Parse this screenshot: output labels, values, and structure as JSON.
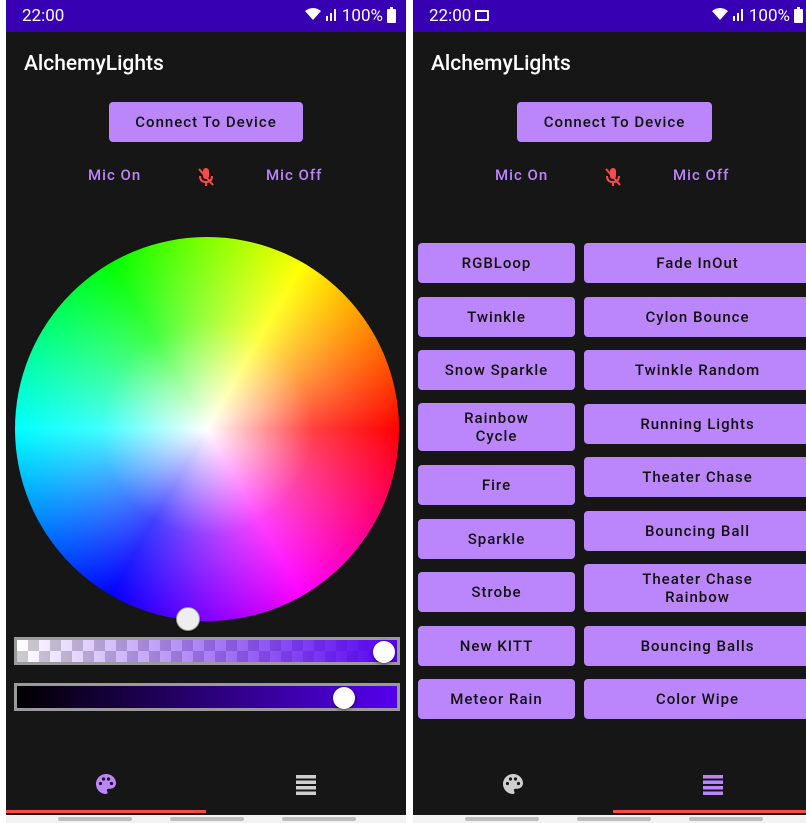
{
  "colors": {
    "accent": "#bb86fc",
    "status_bar": "#3700b3",
    "background": "#161616",
    "tab_indicator": "#ff4a4a",
    "mic_icon": "#ff4a4a"
  },
  "status_bar": {
    "time": "22:00",
    "battery": "100%"
  },
  "app": {
    "title": "AlchemyLights",
    "connect_label": "Connect To Device",
    "mic_on_label": "Mic On",
    "mic_off_label": "Mic Off"
  },
  "color_picker": {
    "selected_color": "#5500ee",
    "opacity": 1.0,
    "brightness": 0.93
  },
  "tabs": [
    {
      "icon": "palette-icon"
    },
    {
      "icon": "menu-icon"
    }
  ],
  "effects": {
    "left_column": [
      "RGBLoop",
      "Twinkle",
      "Snow Sparkle",
      "Rainbow\nCycle",
      "Fire",
      "Sparkle",
      "Strobe",
      "New KITT",
      "Meteor Rain"
    ],
    "right_column": [
      "Fade InOut",
      "Cylon Bounce",
      "Twinkle Random",
      "Running Lights",
      "Theater Chase",
      "Bouncing Ball",
      "Theater Chase\nRainbow",
      "Bouncing Balls",
      "Color Wipe"
    ]
  }
}
